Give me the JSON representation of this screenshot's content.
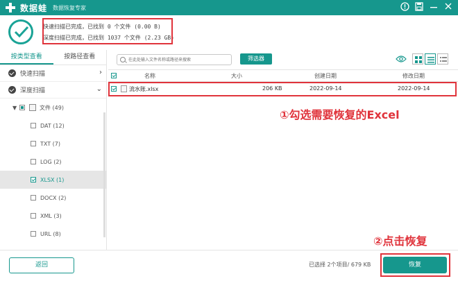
{
  "app": {
    "name": "数据蛙",
    "subtitle": "数据恢复专家"
  },
  "status": {
    "line1": "快速扫描已完成，已找到 0 个文件 (0.00  B)",
    "line2": "深度扫描已完成，已找到 1037 个文件 (2.23 GB)"
  },
  "left": {
    "tabs": [
      "按类型查看",
      "按路径查看"
    ],
    "active_tab": 0,
    "scans": [
      {
        "label": "快速扫描",
        "arrow": "›"
      },
      {
        "label": "深度扫描",
        "arrow": "⌄"
      }
    ],
    "tree_root": {
      "label": "文件 (49)"
    },
    "tree_children": [
      {
        "label": "DAT (12)",
        "checked": false
      },
      {
        "label": "TXT (7)",
        "checked": false
      },
      {
        "label": "LOG (2)",
        "checked": false
      },
      {
        "label": "XLSX (1)",
        "checked": true
      },
      {
        "label": "DOCX (2)",
        "checked": false
      },
      {
        "label": "XML (3)",
        "checked": false
      },
      {
        "label": "URL (8)",
        "checked": false
      }
    ]
  },
  "toolbar": {
    "search_placeholder": "在此处输入文件名称或路径来搜索",
    "filter_label": "筛选器"
  },
  "table": {
    "headers": [
      "名称",
      "大小",
      "创建日期",
      "修改日期"
    ],
    "rows": [
      {
        "name": "流水账.xlsx",
        "size": "206 KB",
        "created": "2022-09-14",
        "modified": "2022-09-14"
      }
    ]
  },
  "annotations": {
    "step1": "①勾选需要恢复的Excel",
    "step2": "②点击恢复"
  },
  "bottom": {
    "back_label": "返回",
    "selected_info": "已选择 2个项目/ 679 KB",
    "recover_label": "恢复"
  },
  "colors": {
    "accent": "#16978d",
    "highlight": "#e0333b"
  }
}
